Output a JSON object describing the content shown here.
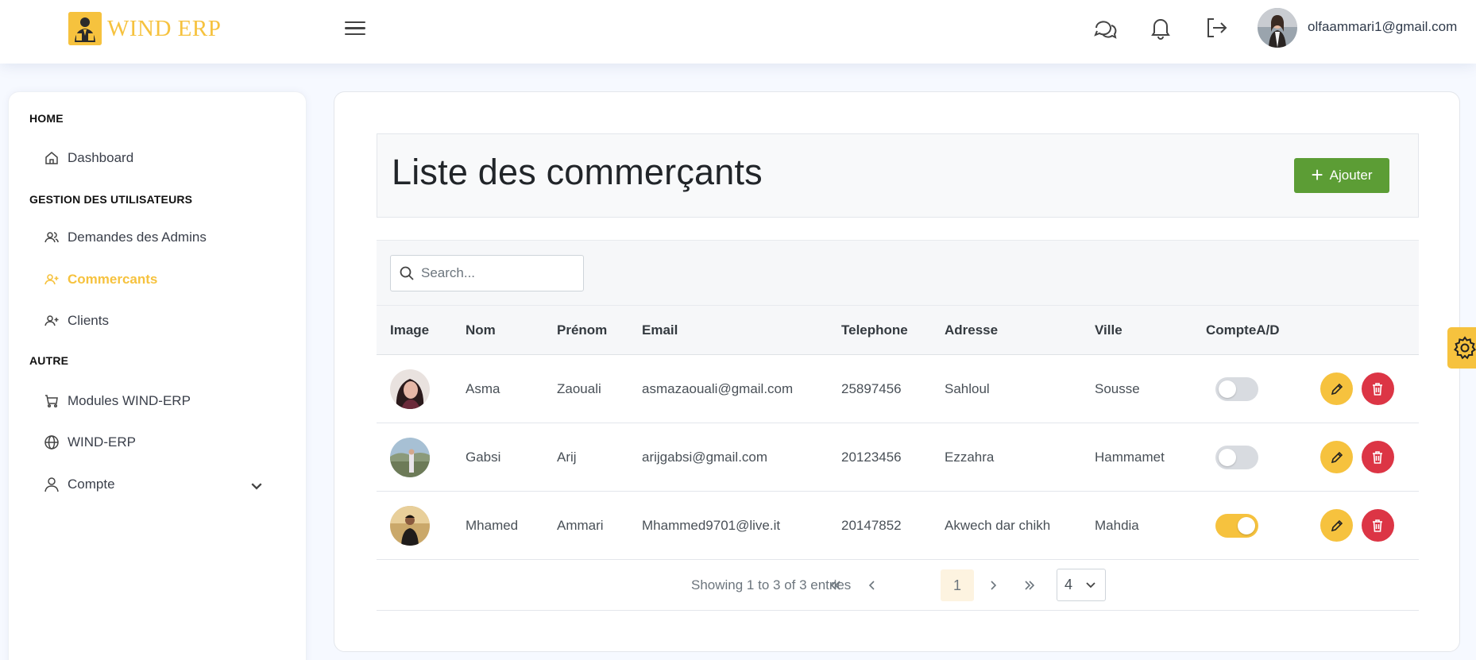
{
  "app": {
    "name": "WIND ERP",
    "brand_color": "#f6c23e"
  },
  "header": {
    "icons": [
      "chat-icon",
      "bell-icon",
      "logout-icon"
    ],
    "user_email": "olfaammari1@gmail.com"
  },
  "sidebar": {
    "sections": [
      {
        "heading": "HOME",
        "items": [
          {
            "label": "Dashboard",
            "icon": "home-icon"
          }
        ]
      },
      {
        "heading": "GESTION DES UTILISATEURS",
        "items": [
          {
            "label": "Demandes des Admins",
            "icon": "users-icon"
          },
          {
            "label": "Commercants",
            "icon": "user-plus-icon",
            "active": true
          },
          {
            "label": "Clients",
            "icon": "user-plus-icon"
          }
        ]
      },
      {
        "heading": "AUTRE",
        "items": [
          {
            "label": "Modules WIND-ERP",
            "icon": "cart-icon"
          },
          {
            "label": "WIND-ERP",
            "icon": "globe-icon"
          },
          {
            "label": "Compte",
            "icon": "person-icon",
            "expandable": true
          }
        ]
      }
    ]
  },
  "main": {
    "title": "Liste des commerçants",
    "add_button": "Ajouter",
    "search": {
      "placeholder": "Search...",
      "value": ""
    },
    "columns": [
      "Image",
      "Nom",
      "Prénom",
      "Email",
      "Telephone",
      "Adresse",
      "Ville",
      "CompteA/D",
      ""
    ],
    "rows": [
      {
        "nom": "Asma",
        "prenom": "Zaouali",
        "email": "asmazaouali@gmail.com",
        "telephone": "25897456",
        "adresse": "Sahloul",
        "ville": "Sousse",
        "active": false
      },
      {
        "nom": "Gabsi",
        "prenom": "Arij",
        "email": "arijgabsi@gmail.com",
        "telephone": "20123456",
        "adresse": "Ezzahra",
        "ville": "Hammamet",
        "active": false
      },
      {
        "nom": "Mhamed",
        "prenom": "Ammari",
        "email": "Mhammed9701@live.it",
        "telephone": "20147852",
        "adresse": "Akwech dar chikh",
        "ville": "Mahdia",
        "active": true
      }
    ],
    "pagination": {
      "info": "Showing 1 to 3 of 3 entries",
      "current_page": "1",
      "page_size": "4"
    }
  },
  "colors": {
    "add_button": "#5c9d35",
    "edit": "#f6c23e",
    "delete": "#dc3545",
    "toggle_on": "#f6c23e",
    "toggle_off": "#d8dbe0"
  }
}
